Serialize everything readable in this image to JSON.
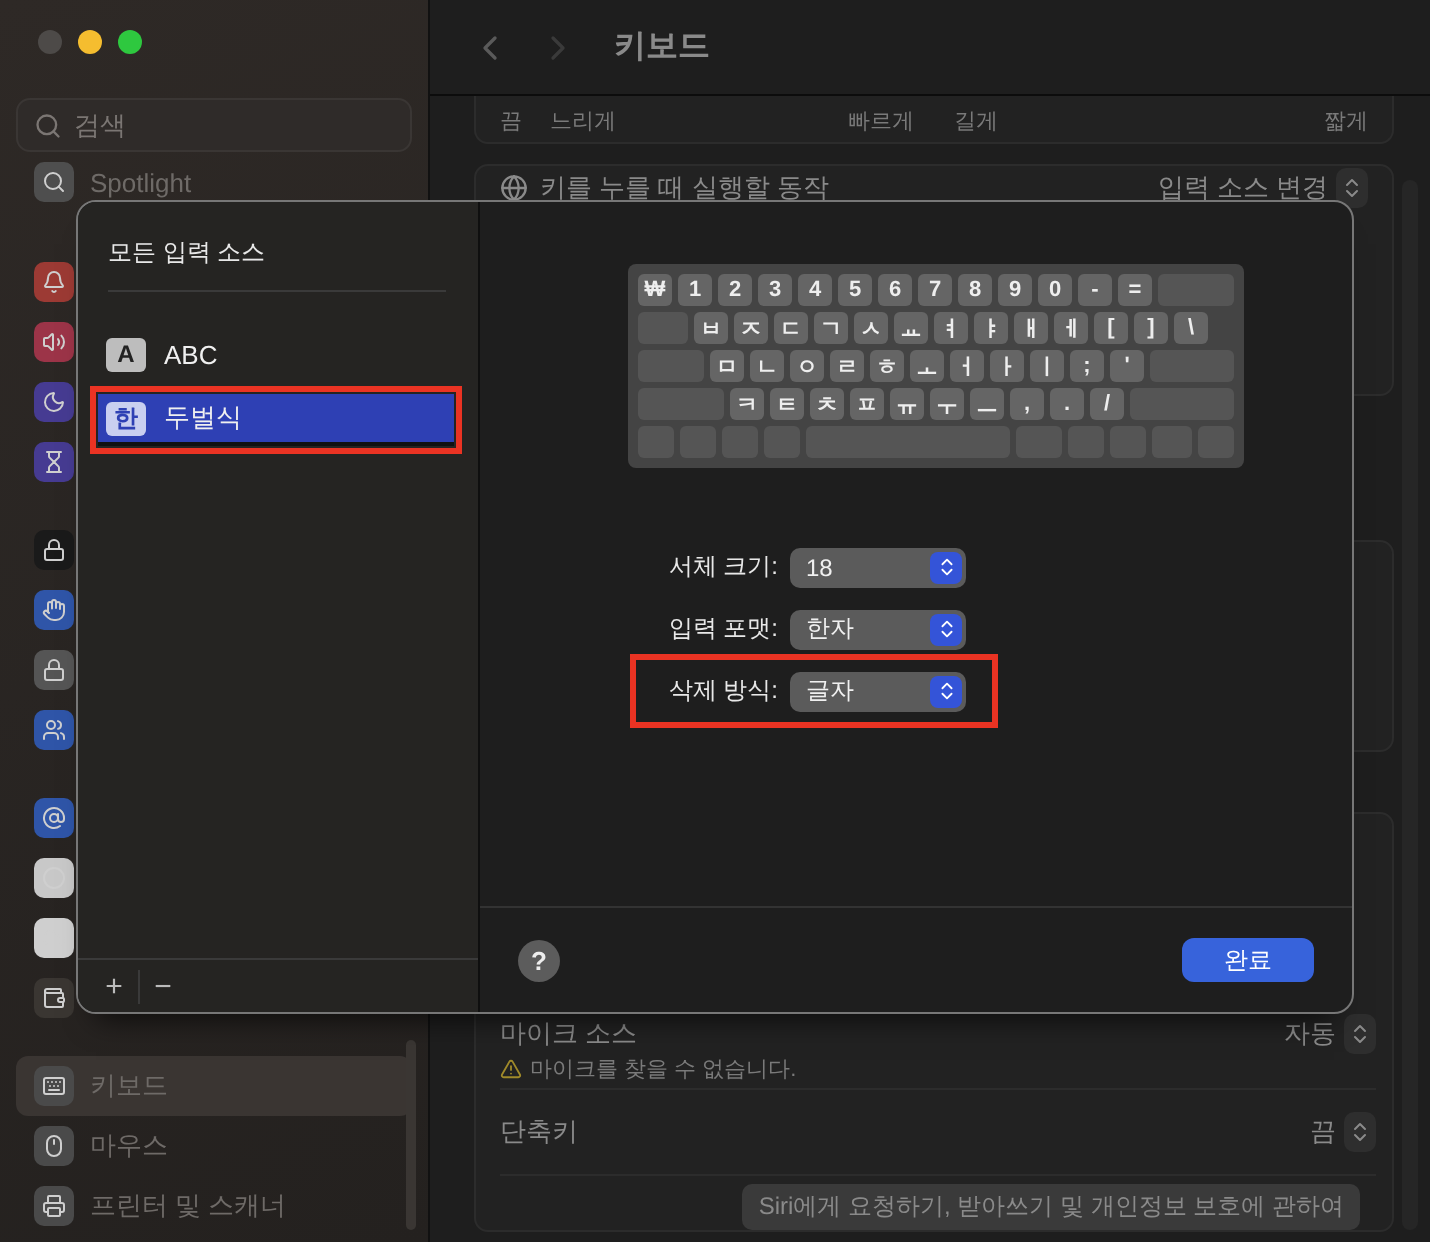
{
  "window": {
    "title": "키보드"
  },
  "sidebar": {
    "search": {
      "placeholder": "검색"
    },
    "groups": [
      {
        "items": [
          {
            "label": "Spotlight",
            "color": "#4e4e4e"
          }
        ]
      },
      {
        "items": [
          {
            "color": "#9c3a34"
          },
          {
            "color": "#9c3448"
          },
          {
            "color": "#463b92"
          },
          {
            "color": "#463b92"
          }
        ]
      },
      {
        "items": [
          {
            "color": "#1a1a1a"
          },
          {
            "color": "#2f55a8"
          },
          {
            "color": "#555555"
          },
          {
            "color": "#2f55a8"
          }
        ]
      },
      {
        "items": [
          {
            "color": "#2f55a8"
          },
          {
            "color": "#c8c8c8"
          },
          {
            "color": "#cfcfcf"
          },
          {
            "color": "#3a3632"
          }
        ]
      },
      {
        "items": [
          {
            "label": "키보드",
            "color": "#4a4a4a",
            "selected": true
          },
          {
            "label": "마우스",
            "color": "#4a4a4a",
            "selected": false
          },
          {
            "label": "프린터 및 스캐너",
            "color": "#4a4a4a",
            "selected": false
          }
        ]
      }
    ]
  },
  "content": {
    "sliders": [
      {
        "labels": [
          "끔",
          "느리게",
          "빠르게"
        ]
      },
      {
        "labels": [
          "길게",
          "짧게"
        ]
      }
    ],
    "action_row": {
      "label": "키를 누를 때 실행할 동작",
      "value": "입력 소스 변경"
    },
    "mic_source": {
      "label": "마이크 소스",
      "value": "자동",
      "warning": "마이크를 찾을 수 없습니다."
    },
    "shortcut": {
      "label": "단축키",
      "value": "끔"
    },
    "siri_button": "Siri에게 요청하기, 받아쓰기 및 개인정보 보호에 관하여"
  },
  "sheet": {
    "input_sources": {
      "title": "모든 입력 소스",
      "items": [
        {
          "badge": "A",
          "label": "ABC",
          "selected": false,
          "highlighted": false
        },
        {
          "badge": "한",
          "label": "두벌식",
          "selected": true,
          "highlighted": true
        }
      ],
      "add": "+",
      "remove": "−"
    },
    "keyboard": {
      "rows": [
        [
          "₩",
          "1",
          "2",
          "3",
          "4",
          "5",
          "6",
          "7",
          "8",
          "9",
          "0",
          "-",
          "="
        ],
        [
          "ㅂ",
          "ㅈ",
          "ㄷ",
          "ㄱ",
          "ㅅ",
          "ㅛ",
          "ㅕ",
          "ㅑ",
          "ㅐ",
          "ㅔ",
          "[",
          "]",
          "\\"
        ],
        [
          "ㅁ",
          "ㄴ",
          "ㅇ",
          "ㄹ",
          "ㅎ",
          "ㅗ",
          "ㅓ",
          "ㅏ",
          "ㅣ",
          ";",
          "'"
        ],
        [
          "ㅋ",
          "ㅌ",
          "ㅊ",
          "ㅍ",
          "ㅠ",
          "ㅜ",
          "ㅡ",
          ",",
          ".",
          "/"
        ]
      ]
    },
    "options": [
      {
        "label": "서체 크기:",
        "value": "18",
        "highlighted": false
      },
      {
        "label": "입력 포맷:",
        "value": "한자",
        "highlighted": false
      },
      {
        "label": "삭제 방식:",
        "value": "글자",
        "highlighted": true
      }
    ],
    "help": "?",
    "done": "완료"
  }
}
